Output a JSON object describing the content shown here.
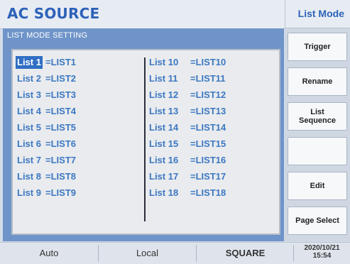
{
  "header": {
    "title": "AC SOURCE",
    "mode": "List Mode"
  },
  "panel": {
    "title": "LIST MODE SETTING",
    "left_rows": [
      {
        "label": "List 1",
        "value": "=LIST1"
      },
      {
        "label": "List 2",
        "value": "=LIST2"
      },
      {
        "label": "List 3",
        "value": "=LIST3"
      },
      {
        "label": "List 4",
        "value": "=LIST4"
      },
      {
        "label": "List 5",
        "value": "=LIST5"
      },
      {
        "label": "List 6",
        "value": "=LIST6"
      },
      {
        "label": "List 7",
        "value": "=LIST7"
      },
      {
        "label": "List 8",
        "value": "=LIST8"
      },
      {
        "label": "List 9",
        "value": "=LIST9"
      }
    ],
    "right_rows": [
      {
        "label": "List 10",
        "value": "=LIST10"
      },
      {
        "label": "List 11",
        "value": "=LIST11"
      },
      {
        "label": "List 12",
        "value": "=LIST12"
      },
      {
        "label": "List 13",
        "value": "=LIST13"
      },
      {
        "label": "List 14",
        "value": "=LIST14"
      },
      {
        "label": "List 15",
        "value": "=LIST15"
      },
      {
        "label": "List 16",
        "value": "=LIST16"
      },
      {
        "label": "List 17",
        "value": "=LIST17"
      },
      {
        "label": "List 18",
        "value": "=LIST18"
      }
    ]
  },
  "buttons": {
    "trigger": "Trigger",
    "rename": "Rename",
    "list_sequence_line1": "List",
    "list_sequence_line2": "Sequence",
    "blank": "",
    "edit": "Edit",
    "page_select": "Page Select"
  },
  "status": {
    "auto": "Auto",
    "local": "Local",
    "waveform": "SQUARE",
    "date": "2020/10/21",
    "time": "15:54"
  },
  "colors": {
    "accent": "#2d62b8",
    "panel": "#6f94c9",
    "selection": "#2f6fc4"
  }
}
